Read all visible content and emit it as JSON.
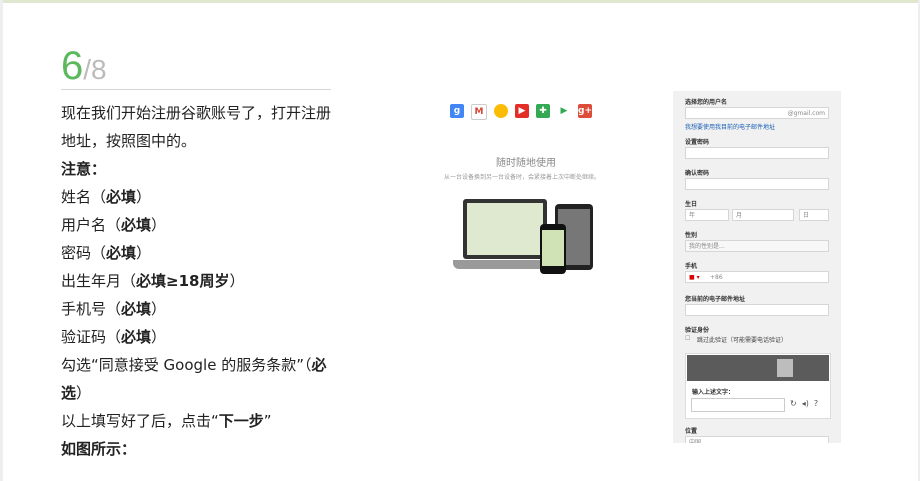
{
  "step": {
    "current": "6",
    "total": "/8"
  },
  "instructions": [
    "现在我们开始注册谷歌账号了，打开注册地址，按照图中的。",
    "注意：",
    "姓名（必填）",
    "用户名（必填）",
    "密码（必填）",
    "出生年月（必填≥18周岁）",
    "手机号（必填）",
    "验证码（必填）",
    "勾选“同意接受 Google 的服务条款”（必选）",
    "以上填写好了后，点击“下一步”",
    "如图所示："
  ],
  "promo": {
    "tagline": "随时随地使用",
    "subtagline": "从一台设备换到另一台设备时，会紧接着上次中断处继续。",
    "icons": [
      "google-search-icon",
      "gmail-icon",
      "chrome-icon",
      "youtube-icon",
      "maps-icon",
      "play-icon",
      "google-plus-icon"
    ]
  },
  "form": {
    "username_label": "选择您的用户名",
    "username_suffix": "@gmail.com",
    "use_existing_email_link": "我想要使用我目前的电子邮件地址",
    "password_label": "设置密码",
    "confirm_password_label": "确认密码",
    "birthday_label": "生日",
    "year_placeholder": "年",
    "month_placeholder": "月",
    "day_placeholder": "日",
    "gender_label": "性别",
    "gender_value": "我的性别是...",
    "phone_label": "手机",
    "phone_prefix": "+86",
    "current_email_label": "您当前的电子邮件地址",
    "verify_label": "验证身份",
    "skip_verify_text": "跳过此验证（可能需要电话验证）",
    "captcha_label": "输入上述文字：",
    "location_label": "位置",
    "location_value": "中国"
  },
  "colors": {
    "accent": "#5cb85c",
    "link": "#1a5fb4"
  }
}
